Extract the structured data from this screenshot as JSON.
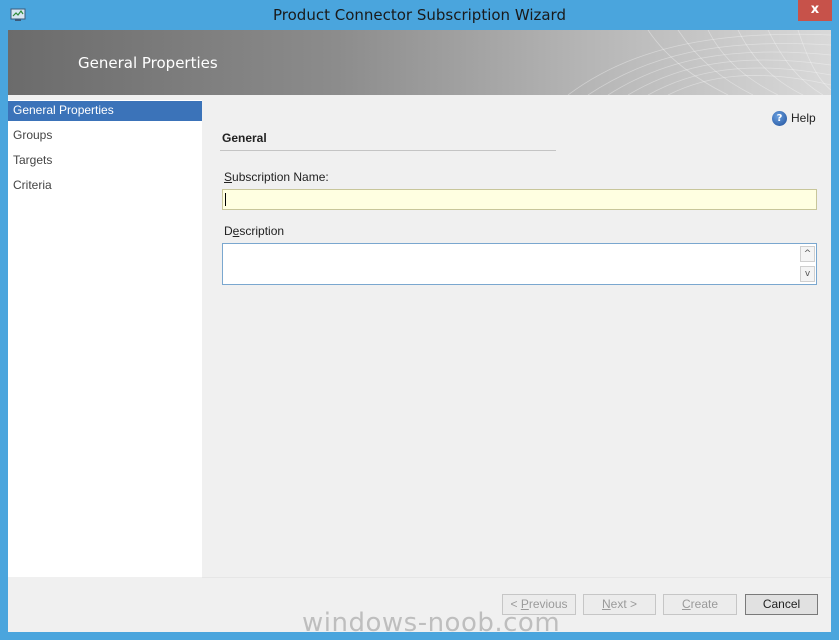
{
  "window": {
    "title": "Product Connector Subscription Wizard",
    "close_glyph": "x"
  },
  "banner": {
    "title": "General Properties"
  },
  "nav": {
    "items": [
      {
        "label": "General Properties",
        "active": true
      },
      {
        "label": "Groups",
        "active": false
      },
      {
        "label": "Targets",
        "active": false
      },
      {
        "label": "Criteria",
        "active": false
      }
    ]
  },
  "help": {
    "label": "Help",
    "icon": "help-icon"
  },
  "section": {
    "title": "General"
  },
  "form": {
    "subscription_name": {
      "label_mnemonic": "S",
      "label_rest": "ubscription Name:",
      "value": ""
    },
    "description": {
      "label_first": "D",
      "label_mnemonic": "e",
      "label_rest": "scription",
      "value": ""
    },
    "scroll_up_glyph": "^",
    "scroll_down_glyph": "v"
  },
  "buttons": {
    "previous_prefix": "< ",
    "previous_mnemonic": "P",
    "previous_rest": "revious",
    "next_mnemonic": "N",
    "next_rest": "ext >",
    "create_mnemonic": "C",
    "create_rest": "reate",
    "cancel": "Cancel"
  },
  "watermark": "windows-noob.com",
  "colors": {
    "titlebar": "#4aa5dd",
    "nav_active": "#3b73b9",
    "input_highlight": "#ffffe1"
  }
}
